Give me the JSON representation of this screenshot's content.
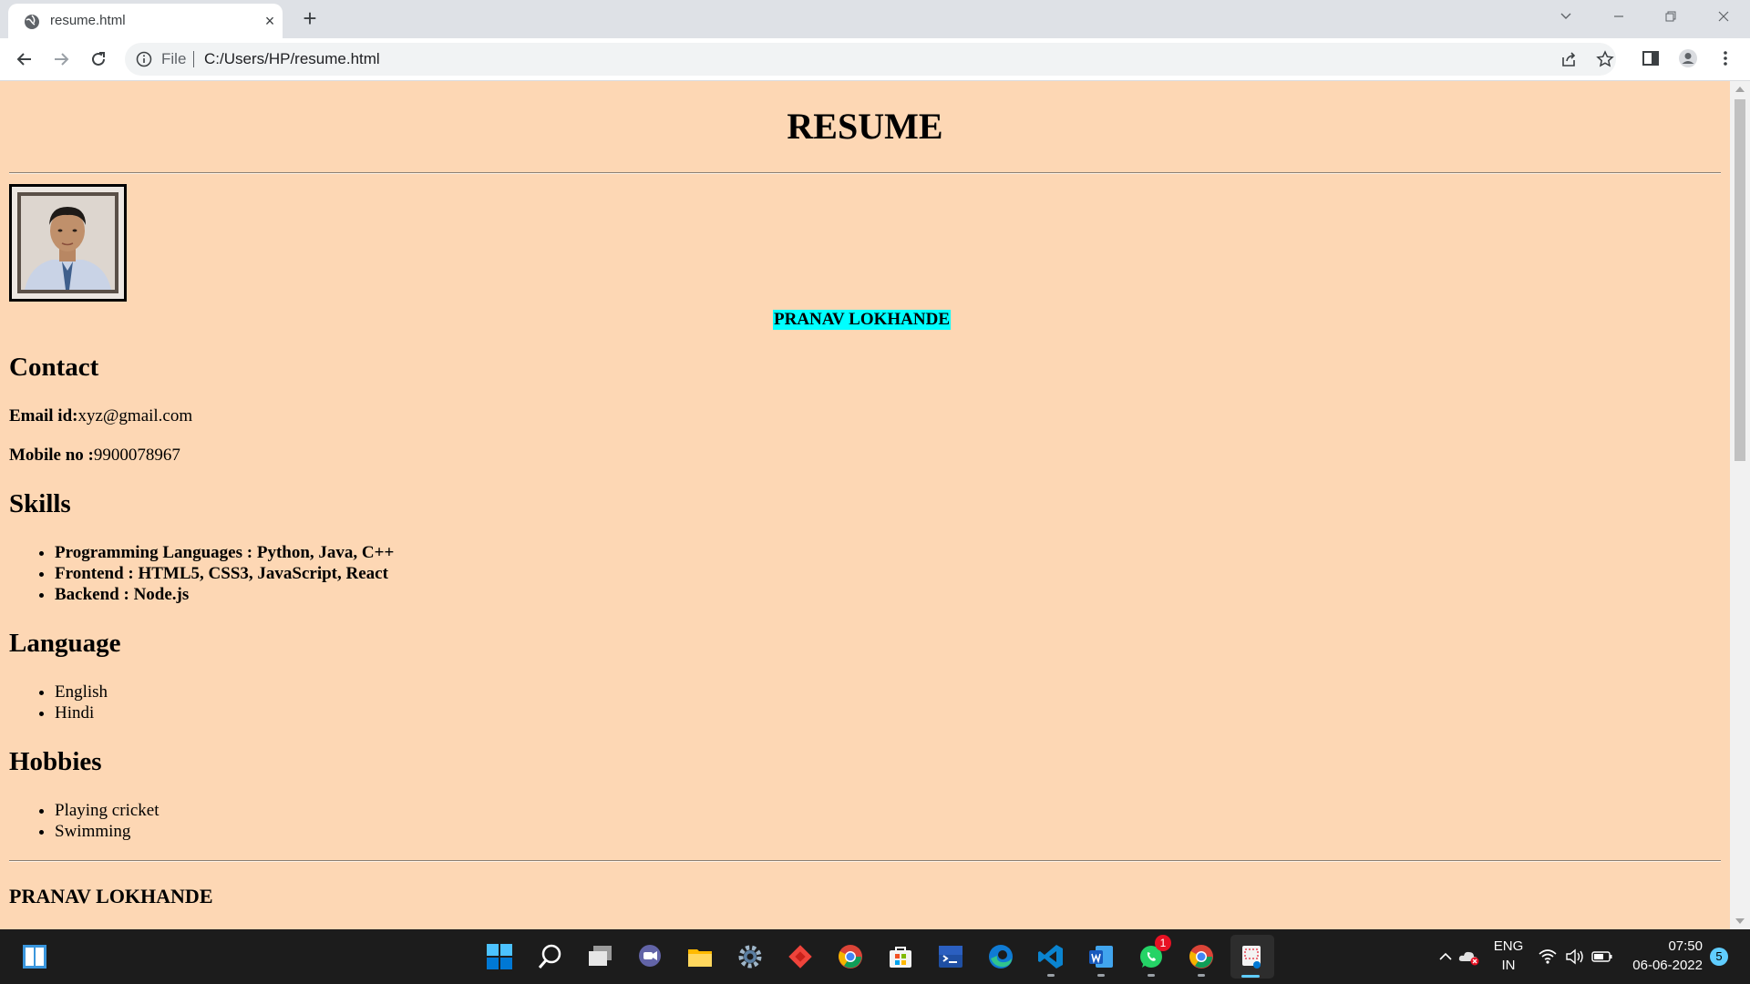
{
  "browser": {
    "tab_title": "resume.html",
    "new_tab_symbol": "+",
    "close_tab_symbol": "×",
    "url_scheme_label": "File",
    "url": "C:/Users/HP/resume.html"
  },
  "page": {
    "title": "RESUME",
    "name_highlight": "PRANAV LOKHANDE",
    "contact": {
      "heading": "Contact",
      "email_label": "Email id:",
      "email_value": "xyz@gmail.com",
      "mobile_label": "Mobile no :",
      "mobile_value": "9900078967"
    },
    "skills": {
      "heading": "Skills",
      "items": [
        "Programming Languages : Python, Java, C++",
        "Frontend : HTML5, CSS3, JavaScript, React",
        "Backend : Node.js"
      ]
    },
    "language": {
      "heading": "Language",
      "items": [
        "English",
        "Hindi"
      ]
    },
    "hobbies": {
      "heading": "Hobbies",
      "items": [
        "Playing cricket",
        "Swimming"
      ]
    },
    "footer_name": "PRANAV LOKHANDE"
  },
  "taskbar": {
    "whatsapp_badge": "1",
    "lang_top": "ENG",
    "lang_bottom": "IN",
    "time": "07:50",
    "date": "06-06-2022",
    "notification_count": "5"
  },
  "colors": {
    "page_background": "#fdd7b4",
    "name_highlight": "#00ffff",
    "taskbar": "#1c1c1c"
  }
}
